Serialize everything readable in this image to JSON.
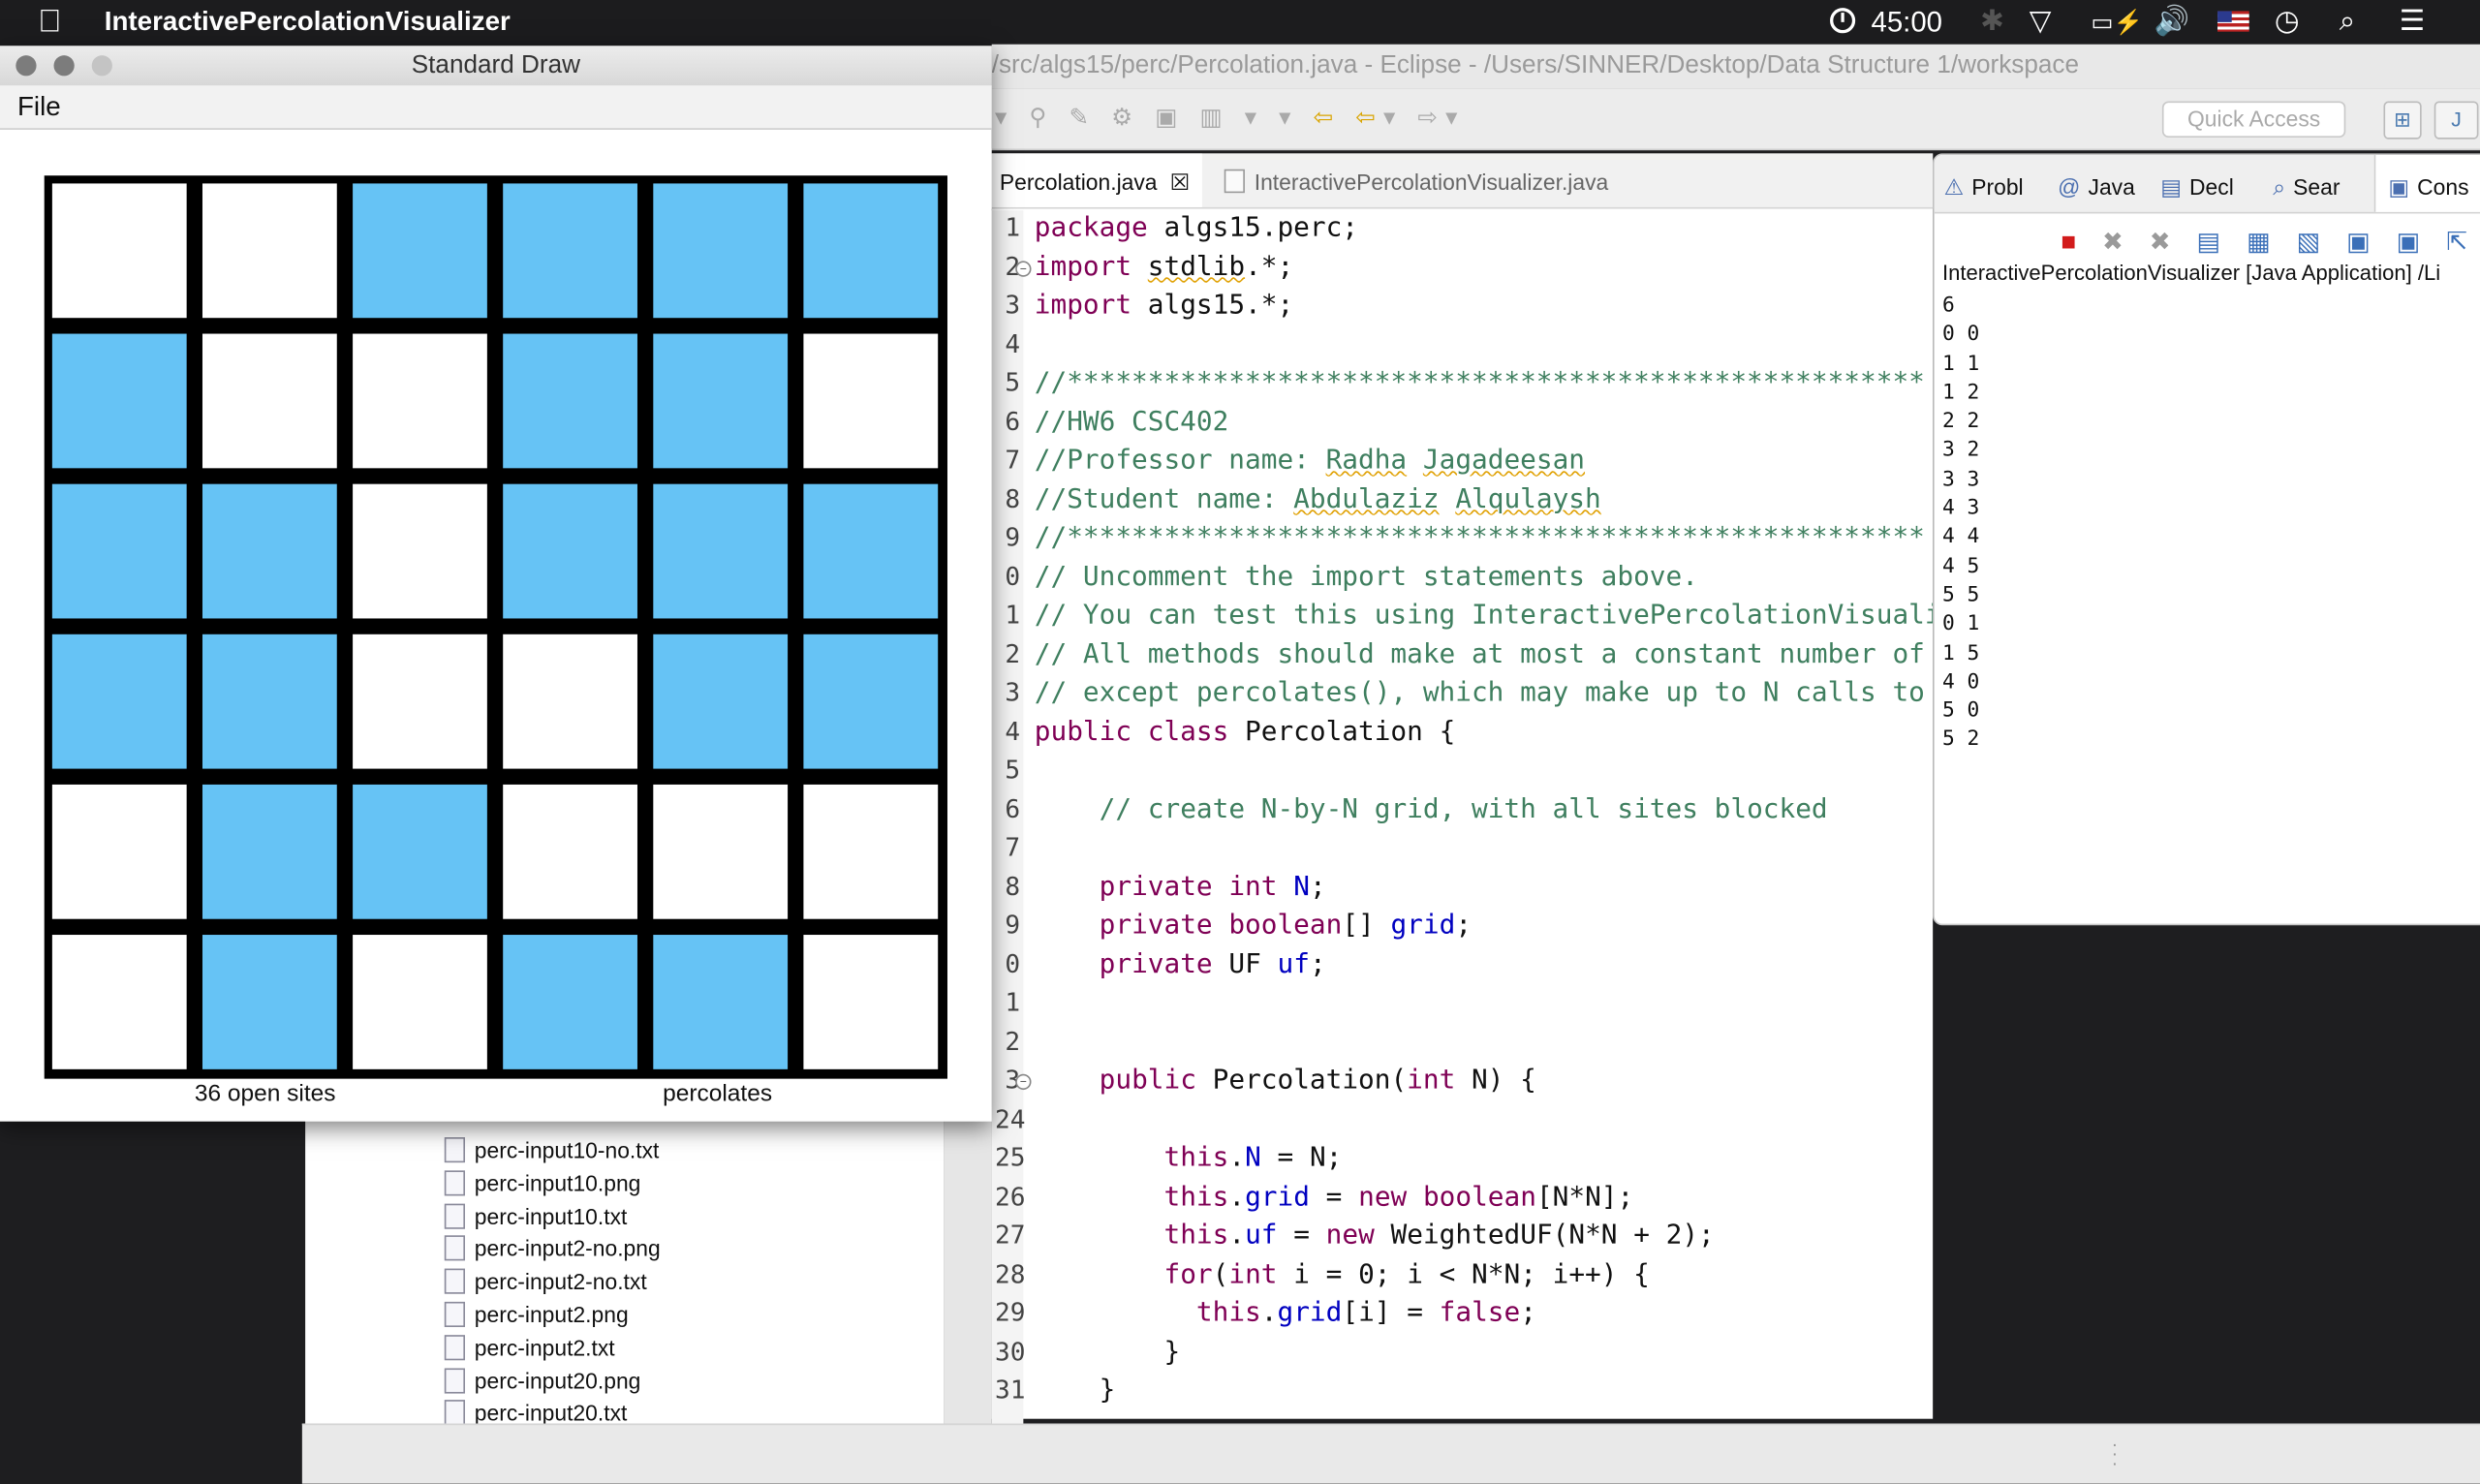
{
  "menubar": {
    "app_name": "InteractivePercolationVisualizer",
    "clock": "45:00"
  },
  "eclipse": {
    "title": "/src/algs15/perc/Percolation.java - Eclipse - /Users/SINNER/Desktop/Data Structure 1/workspace",
    "quick_access_placeholder": "Quick Access",
    "tabs": {
      "active": "Percolation.java",
      "inactive": "InteractivePercolationVisualizer.java"
    }
  },
  "console": {
    "tabs": [
      "Probl",
      "Java",
      "Decl",
      "Sear",
      "Cons"
    ],
    "header": "InteractivePercolationVisualizer [Java Application] /Li",
    "output": [
      "6",
      "0 0",
      "1 1",
      "1 2",
      "2 2",
      "3 2",
      "3 3",
      "4 3",
      "4 4",
      "4 5",
      "5 5",
      "0 1",
      "1 5",
      "4 0",
      "5 0",
      "5 2"
    ]
  },
  "package_explorer": {
    "files": [
      "perc-input10-no.txt",
      "perc-input10.png",
      "perc-input10.txt",
      "perc-input2-no.png",
      "perc-input2-no.txt",
      "perc-input2.png",
      "perc-input2.txt",
      "perc-input20.png",
      "perc-input20.txt"
    ]
  },
  "standard_draw": {
    "title": "Standard Draw",
    "menu_file": "File",
    "grid_size": 6,
    "colors": {
      "open": "#ffffff",
      "full": "#66c3f5",
      "blocked": "#000000"
    },
    "grid": [
      [
        "open",
        "open",
        "full",
        "full",
        "full",
        "full"
      ],
      [
        "full",
        "open",
        "open",
        "full",
        "full",
        "open"
      ],
      [
        "full",
        "full",
        "open",
        "full",
        "full",
        "full"
      ],
      [
        "full",
        "full",
        "open",
        "open",
        "full",
        "full"
      ],
      [
        "open",
        "full",
        "full",
        "open",
        "open",
        "open"
      ],
      [
        "open",
        "full",
        "open",
        "full",
        "full",
        "open"
      ]
    ],
    "status_left": "36 open sites",
    "status_right": "percolates"
  }
}
